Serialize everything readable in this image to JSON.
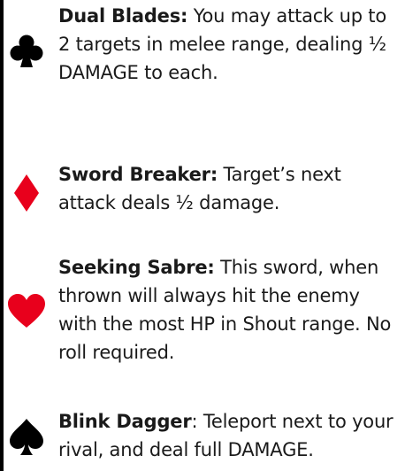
{
  "cards": [
    {
      "suit": "club-icon",
      "color": "#000000",
      "name": "Dual Blades:",
      "name_suffix": "",
      "description": " You may attack up to 2 targets in melee range, dealing ½ DAMAGE to each."
    },
    {
      "suit": "diamond-icon",
      "color": "#e8001c",
      "name": "Sword Breaker:",
      "name_suffix": "",
      "description": " Target’s next attack deals ½ damage."
    },
    {
      "suit": "heart-icon",
      "color": "#e8001c",
      "name": "Seeking Sabre:",
      "name_suffix": "",
      "description": " This sword, when thrown will always hit the enemy with the most HP in Shout range. No roll required."
    },
    {
      "suit": "spade-icon",
      "color": "#000000",
      "name": "Blink Dagger",
      "name_suffix": ":",
      "description": " Teleport next to your rival, and deal full DAMAGE."
    }
  ]
}
